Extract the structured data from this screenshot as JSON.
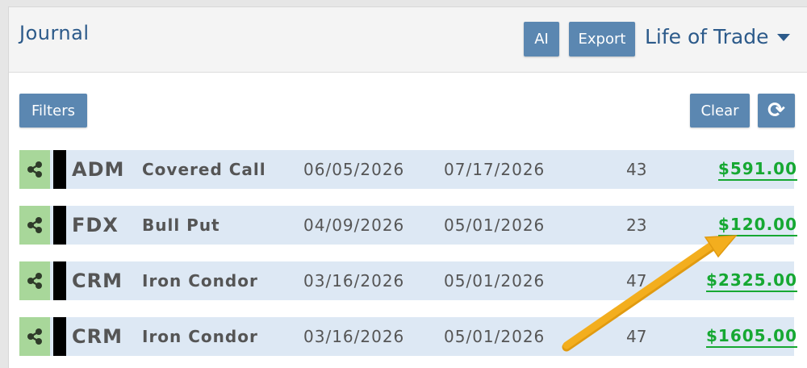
{
  "header": {
    "title": "Journal",
    "ai_label": "AI",
    "export_label": "Export",
    "mode_selected": "Life of Trade"
  },
  "toolbar": {
    "filters_label": "Filters",
    "clear_label": "Clear",
    "refresh_icon": "refresh-icon"
  },
  "rows": [
    {
      "symbol": "ADM",
      "strategy": "Covered Call",
      "open_date": "06/05/2026",
      "close_date": "07/17/2026",
      "days": "43",
      "amount": "$591.00"
    },
    {
      "symbol": "FDX",
      "strategy": "Bull Put",
      "open_date": "04/09/2026",
      "close_date": "05/01/2026",
      "days": "23",
      "amount": "$120.00"
    },
    {
      "symbol": "CRM",
      "strategy": "Iron Condor",
      "open_date": "03/16/2026",
      "close_date": "05/01/2026",
      "days": "47",
      "amount": "$2325.00"
    },
    {
      "symbol": "CRM",
      "strategy": "Iron Condor",
      "open_date": "03/16/2026",
      "close_date": "05/01/2026",
      "days": "47",
      "amount": "$1605.00"
    }
  ],
  "colors": {
    "accent": "#5b87b1",
    "title": "#2c5a8a",
    "profit": "#16a832",
    "share_bg": "#a8d79a",
    "row_bg": "#dde8f4",
    "annotation_arrow": "#f0a818"
  }
}
